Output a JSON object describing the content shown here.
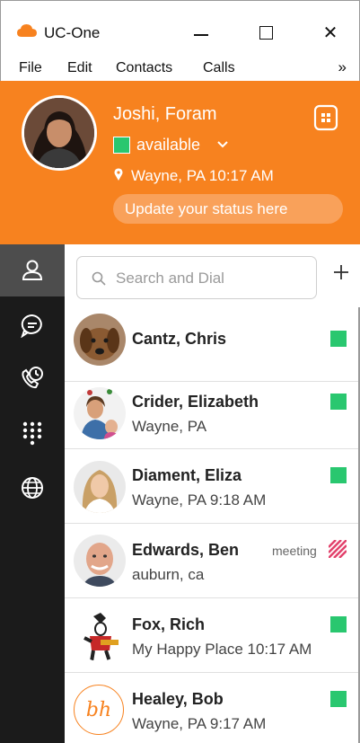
{
  "window": {
    "title": "UC-One",
    "icon": "cloud-icon",
    "controls": [
      "minimize-icon",
      "maximize-icon",
      "close-icon"
    ],
    "close_glyph": "✕"
  },
  "menu": {
    "items": [
      "File",
      "Edit",
      "Contacts",
      "Calls"
    ],
    "more_glyph": "»"
  },
  "header": {
    "name": "Joshi, Foram",
    "status": "available",
    "location": "Wayne, PA  10:17 AM",
    "update_placeholder": "Update your status here",
    "accent": "#f7821f",
    "status_color": "#29c76f"
  },
  "nav": [
    {
      "name": "contacts",
      "icon": "person-icon",
      "active": true
    },
    {
      "name": "chat",
      "icon": "chat-bubble-icon",
      "active": false
    },
    {
      "name": "call-history",
      "icon": "phone-clock-icon",
      "active": false
    },
    {
      "name": "dialpad",
      "icon": "dialpad-icon",
      "active": false
    },
    {
      "name": "web",
      "icon": "globe-icon",
      "active": false
    }
  ],
  "search": {
    "placeholder": "Search and Dial"
  },
  "add_glyph": "+",
  "contacts": [
    {
      "name": "Cantz, Chris",
      "sub": "",
      "presence": "available",
      "status_label": ""
    },
    {
      "name": "Crider, Elizabeth",
      "sub": "Wayne, PA",
      "presence": "available",
      "status_label": ""
    },
    {
      "name": "Diament, Eliza",
      "sub": "Wayne, PA 9:18 AM",
      "presence": "available",
      "status_label": ""
    },
    {
      "name": "Edwards, Ben",
      "sub": "auburn, ca",
      "presence": "busy",
      "status_label": "meeting"
    },
    {
      "name": "Fox, Rich",
      "sub": "My Happy Place 10:17 AM",
      "presence": "available",
      "status_label": ""
    },
    {
      "name": "Healey, Bob",
      "sub": "Wayne, PA 9:17 AM",
      "presence": "available",
      "status_label": "",
      "initials": "bh"
    }
  ]
}
